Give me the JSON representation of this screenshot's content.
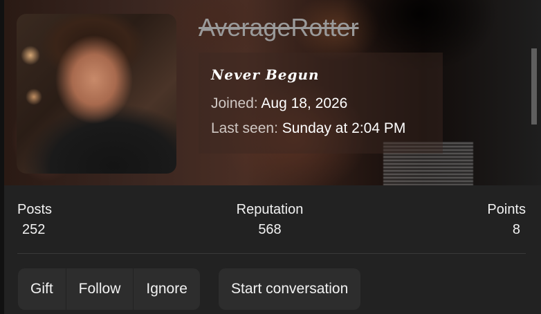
{
  "profile": {
    "username": "AverageRotter",
    "user_title": "Never Begun",
    "joined_label": "Joined:",
    "joined_value": "Aug 18, 2026",
    "last_seen_label": "Last seen:",
    "last_seen_value": "Sunday at 2:04 PM"
  },
  "stats": {
    "posts_label": "Posts",
    "posts_value": "252",
    "reputation_label": "Reputation",
    "reputation_value": "568",
    "points_label": "Points",
    "points_value": "8"
  },
  "actions": {
    "gift": "Gift",
    "follow": "Follow",
    "ignore": "Ignore",
    "start_conversation": "Start conversation"
  },
  "icons": {
    "avatar": "user-avatar-image",
    "banner": "profile-banner-image"
  }
}
